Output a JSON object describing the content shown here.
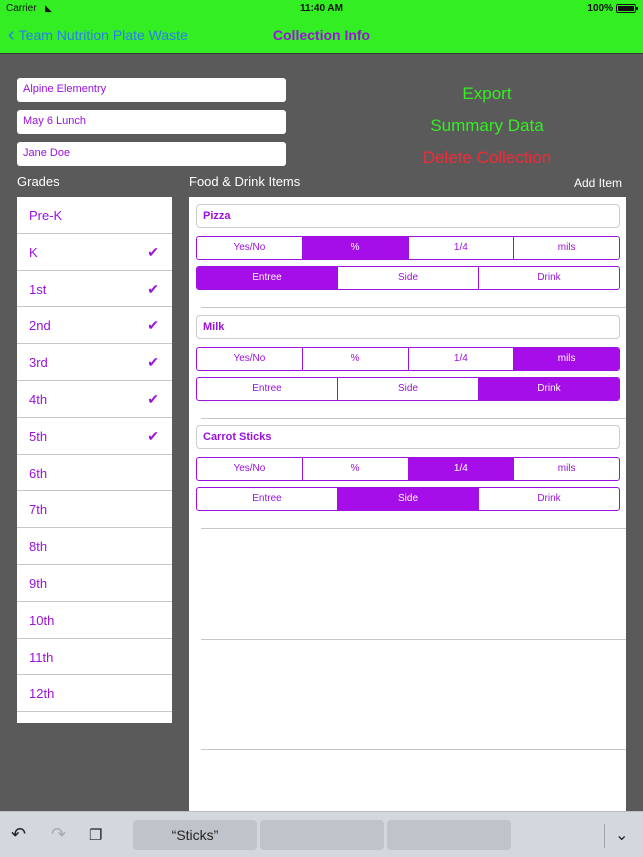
{
  "status": {
    "carrier": "Carrier",
    "wifi_icon": "wifi-icon",
    "time": "11:40 AM",
    "battery": "100%",
    "battery_level": 1.0
  },
  "nav": {
    "back_label": "Team Nutrition Plate Waste",
    "title": "Collection Info"
  },
  "fields": {
    "school": "Alpine Elementry",
    "meal": "May 6 Lunch",
    "collector": "Jane Doe"
  },
  "actions": {
    "export": "Export",
    "summary": "Summary Data",
    "delete": "Delete Collection"
  },
  "sections": {
    "grades": "Grades",
    "items": "Food & Drink Items",
    "add_item": "Add Item"
  },
  "grades": [
    {
      "label": "Pre-K",
      "checked": false
    },
    {
      "label": "K",
      "checked": true
    },
    {
      "label": "1st",
      "checked": true
    },
    {
      "label": "2nd",
      "checked": true
    },
    {
      "label": "3rd",
      "checked": true
    },
    {
      "label": "4th",
      "checked": true
    },
    {
      "label": "5th",
      "checked": true
    },
    {
      "label": "6th",
      "checked": false
    },
    {
      "label": "7th",
      "checked": false
    },
    {
      "label": "8th",
      "checked": false
    },
    {
      "label": "9th",
      "checked": false
    },
    {
      "label": "10th",
      "checked": false
    },
    {
      "label": "11th",
      "checked": false
    },
    {
      "label": "12th",
      "checked": false
    }
  ],
  "measure_options": [
    "Yes/No",
    "%",
    "1/4",
    "mils"
  ],
  "category_options": [
    "Entree",
    "Side",
    "Drink"
  ],
  "items": [
    {
      "name": "Pizza",
      "measure": "%",
      "category": "Entree"
    },
    {
      "name": "Milk",
      "measure": "mils",
      "category": "Drink"
    },
    {
      "name": "Carrot Sticks",
      "measure": "1/4",
      "category": "Side"
    }
  ],
  "keyboard": {
    "suggestion_1": "“Sticks”",
    "suggestion_2": "",
    "suggestion_3": ""
  },
  "colors": {
    "accent_green": "#33ee22",
    "accent_purple": "#9b12dc",
    "selected_purple": "#a50ee8",
    "danger_red": "#f12a38",
    "link_blue": "#2b7cf6"
  }
}
